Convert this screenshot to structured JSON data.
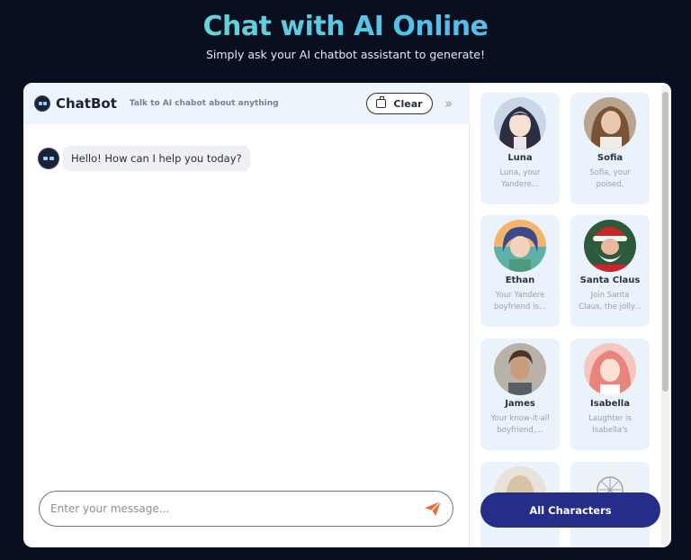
{
  "hero": {
    "title": "Chat with AI Online",
    "subtitle": "Simply ask your AI chatbot assistant to generate!"
  },
  "chat": {
    "name": "ChatBot",
    "tagline": "Talk to AI chabot about anything",
    "clear_label": "Clear",
    "messages": [
      {
        "sender": "bot",
        "text": "Hello! How can I help you today?"
      }
    ],
    "input_placeholder": "Enter your message..."
  },
  "characters": [
    {
      "name": "Luna",
      "desc": "Luna, your\nYandere..."
    },
    {
      "name": "Sofia",
      "desc": "Sofia, your\npoised, mature..."
    },
    {
      "name": "Ethan",
      "desc": "Your Yandere\nboyfriend is..."
    },
    {
      "name": "Santa Claus",
      "desc": "Join Santa\nClaus, the jolly..."
    },
    {
      "name": "James",
      "desc": "Your know-it-all\nboyfriend,..."
    },
    {
      "name": "Isabella",
      "desc": "Laughter is\nIsabella's secre..."
    }
  ],
  "all_characters_label": "All Characters",
  "colors": {
    "background": "#0a0f1f",
    "accent_button": "#262d88",
    "send_icon": "#f06a3a",
    "card": "#eaf2fb"
  },
  "icons": [
    "robot-avatar-icon",
    "broom-icon",
    "double-chevron-right-icon",
    "send-icon"
  ]
}
